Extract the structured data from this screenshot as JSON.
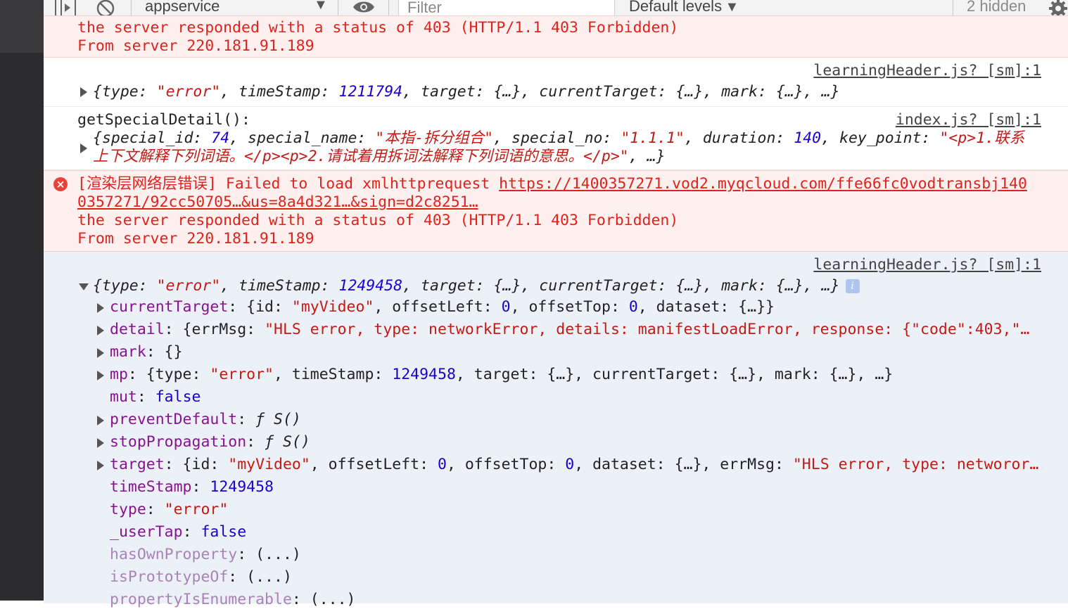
{
  "toolbar": {
    "context": "appservice",
    "filter_placeholder": "Filter",
    "levels": "Default levels",
    "hidden": "2 hidden"
  },
  "messages": {
    "m1": {
      "line1": "the server responded with a status of 403 (HTTP/1.1 403 Forbidden)",
      "line2": "From server 220.181.91.189"
    },
    "m2": {
      "source": "learningHeader.js? [sm]:1",
      "type": "\"error\"",
      "ts": "1211794",
      "ellipsis": "{…}",
      "end": "…}"
    },
    "m3": {
      "label": "getSpecialDetail():",
      "source": "index.js? [sm]:1",
      "special_id": "74",
      "special_name": "\"本指-拆分组合\"",
      "special_no": "\"1.1.1\"",
      "duration": "140",
      "key_point_a": "\"<p>1.联系",
      "key_point_b": "上下文解释下列词语。</p><p>2.请试着用拆词法解释下列词语的意思。</p>\"",
      "end": "…}"
    },
    "m4": {
      "prefix": "[渲染层网络层错误] Failed to load xmlhttprequest ",
      "url_a": "https://1400357271.vod2.myqcloud.com/ffe66fc0vodtransbj140",
      "url_b": "0357271/92cc50705…&us=8a4d321…&sign=d2c8251…",
      "line3": "the server responded with a status of 403 (HTTP/1.1 403 Forbidden)",
      "line4": "From server 220.181.91.189"
    },
    "m5": {
      "source": "learningHeader.js? [sm]:1",
      "type": "\"error\"",
      "ts": "1249458",
      "ellipsis": "{…}",
      "end": "…}",
      "info": "i",
      "props": {
        "currentTarget_id": "\"myVideo\"",
        "zero": "0",
        "detail_errMsg": "\"HLS error, type: networkError, details: manifestLoadError, response: {\"code\":403,\"…",
        "mark_value": "{}",
        "mp_type": "\"error\"",
        "mp_ts": "1249458",
        "mut": "false",
        "preventDefault": "ƒ S()",
        "stopPropagation": "ƒ S()",
        "target_id": "\"myVideo\"",
        "target_errMsg": "\"HLS error, type: networor…",
        "timeStamp": "1249458",
        "type": "\"error\"",
        "_userTap": "false",
        "hasOwnProperty": "(...)",
        "isPrototypeOf": "(...)",
        "propertyIsEnumerable": "(...)"
      }
    }
  },
  "colors": {
    "error_bg": "#fff0f0",
    "error_text": "#e0221c",
    "selected_bg": "#ecf1f8",
    "key": "#881391",
    "string": "#c41a16",
    "number": "#1c00cf"
  }
}
